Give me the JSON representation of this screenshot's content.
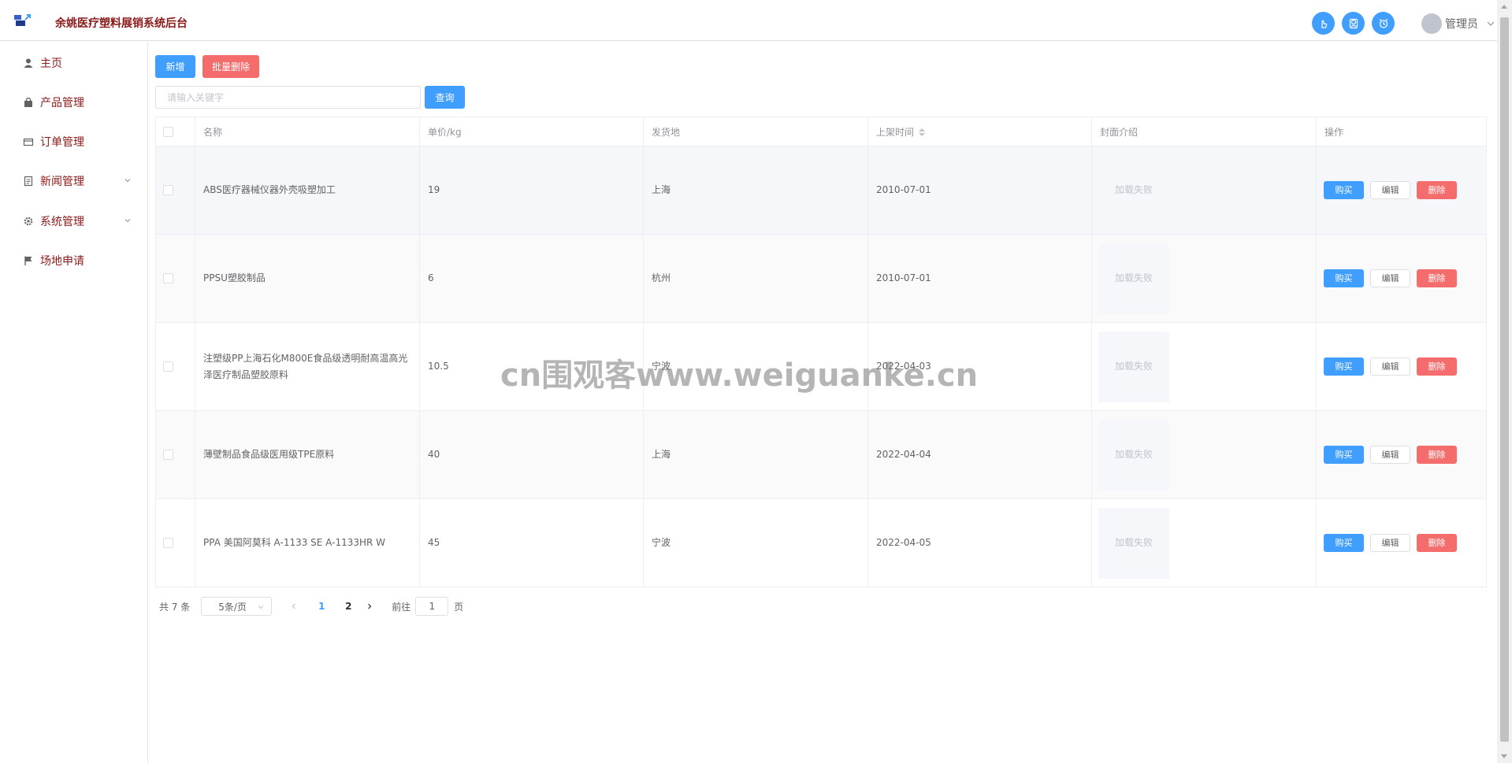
{
  "header": {
    "app_title": "余姚医疗塑料展销系统后台",
    "user_name": "管理员",
    "action_icons": [
      "hand-pointer-icon",
      "user-badge-icon",
      "alarm-clock-icon"
    ]
  },
  "sidebar": {
    "items": [
      {
        "label": "主页",
        "icon": "user-icon"
      },
      {
        "label": "产品管理",
        "icon": "shopping-bag-icon"
      },
      {
        "label": "订单管理",
        "icon": "wallet-icon"
      },
      {
        "label": "新闻管理",
        "icon": "document-icon",
        "expandable": true
      },
      {
        "label": "系统管理",
        "icon": "gear-icon",
        "expandable": true
      },
      {
        "label": "场地申请",
        "icon": "flag-icon"
      }
    ]
  },
  "toolbar": {
    "add_label": "新增",
    "batch_delete_label": "批量删除",
    "search_placeholder": "请输入关键字",
    "search_value": "",
    "query_label": "查询"
  },
  "table": {
    "columns": [
      "名称",
      "单价/kg",
      "发货地",
      "上架时间",
      "封面介绍",
      "操作"
    ],
    "rows": [
      {
        "name": "ABS医疗器械仪器外壳吸塑加工",
        "price": "19",
        "origin": "上海",
        "date": "2010-07-01",
        "cover": "加载失败"
      },
      {
        "name": "PPSU塑胶制品",
        "price": "6",
        "origin": "杭州",
        "date": "2010-07-01",
        "cover": "加载失败"
      },
      {
        "name": "注塑级PP上海石化M800E食品级透明耐高温高光泽医疗制品塑胶原料",
        "price": "10.5",
        "origin": "宁波",
        "date": "2022-04-03",
        "cover": "加载失败"
      },
      {
        "name": "薄壁制品食品级医用级TPE原料",
        "price": "40",
        "origin": "上海",
        "date": "2022-04-04",
        "cover": "加载失败"
      },
      {
        "name": "PPA 美国阿莫科 A-1133 SE A-1133HR W",
        "price": "45",
        "origin": "宁波",
        "date": "2022-04-05",
        "cover": "加载失败"
      }
    ],
    "actions": {
      "buy": "购买",
      "edit": "编辑",
      "delete": "删除"
    }
  },
  "pagination": {
    "total_text": "共 7 条",
    "page_size": "5条/页",
    "pages": [
      "1",
      "2"
    ],
    "current_page": "1",
    "goto_prefix": "前往",
    "goto_value": "1",
    "goto_suffix": "页"
  },
  "watermark": "cn围观客www.weiguanke.cn",
  "colors": {
    "primary": "#409eff",
    "danger": "#f56c6c",
    "brand_text": "#8b1a1a"
  }
}
